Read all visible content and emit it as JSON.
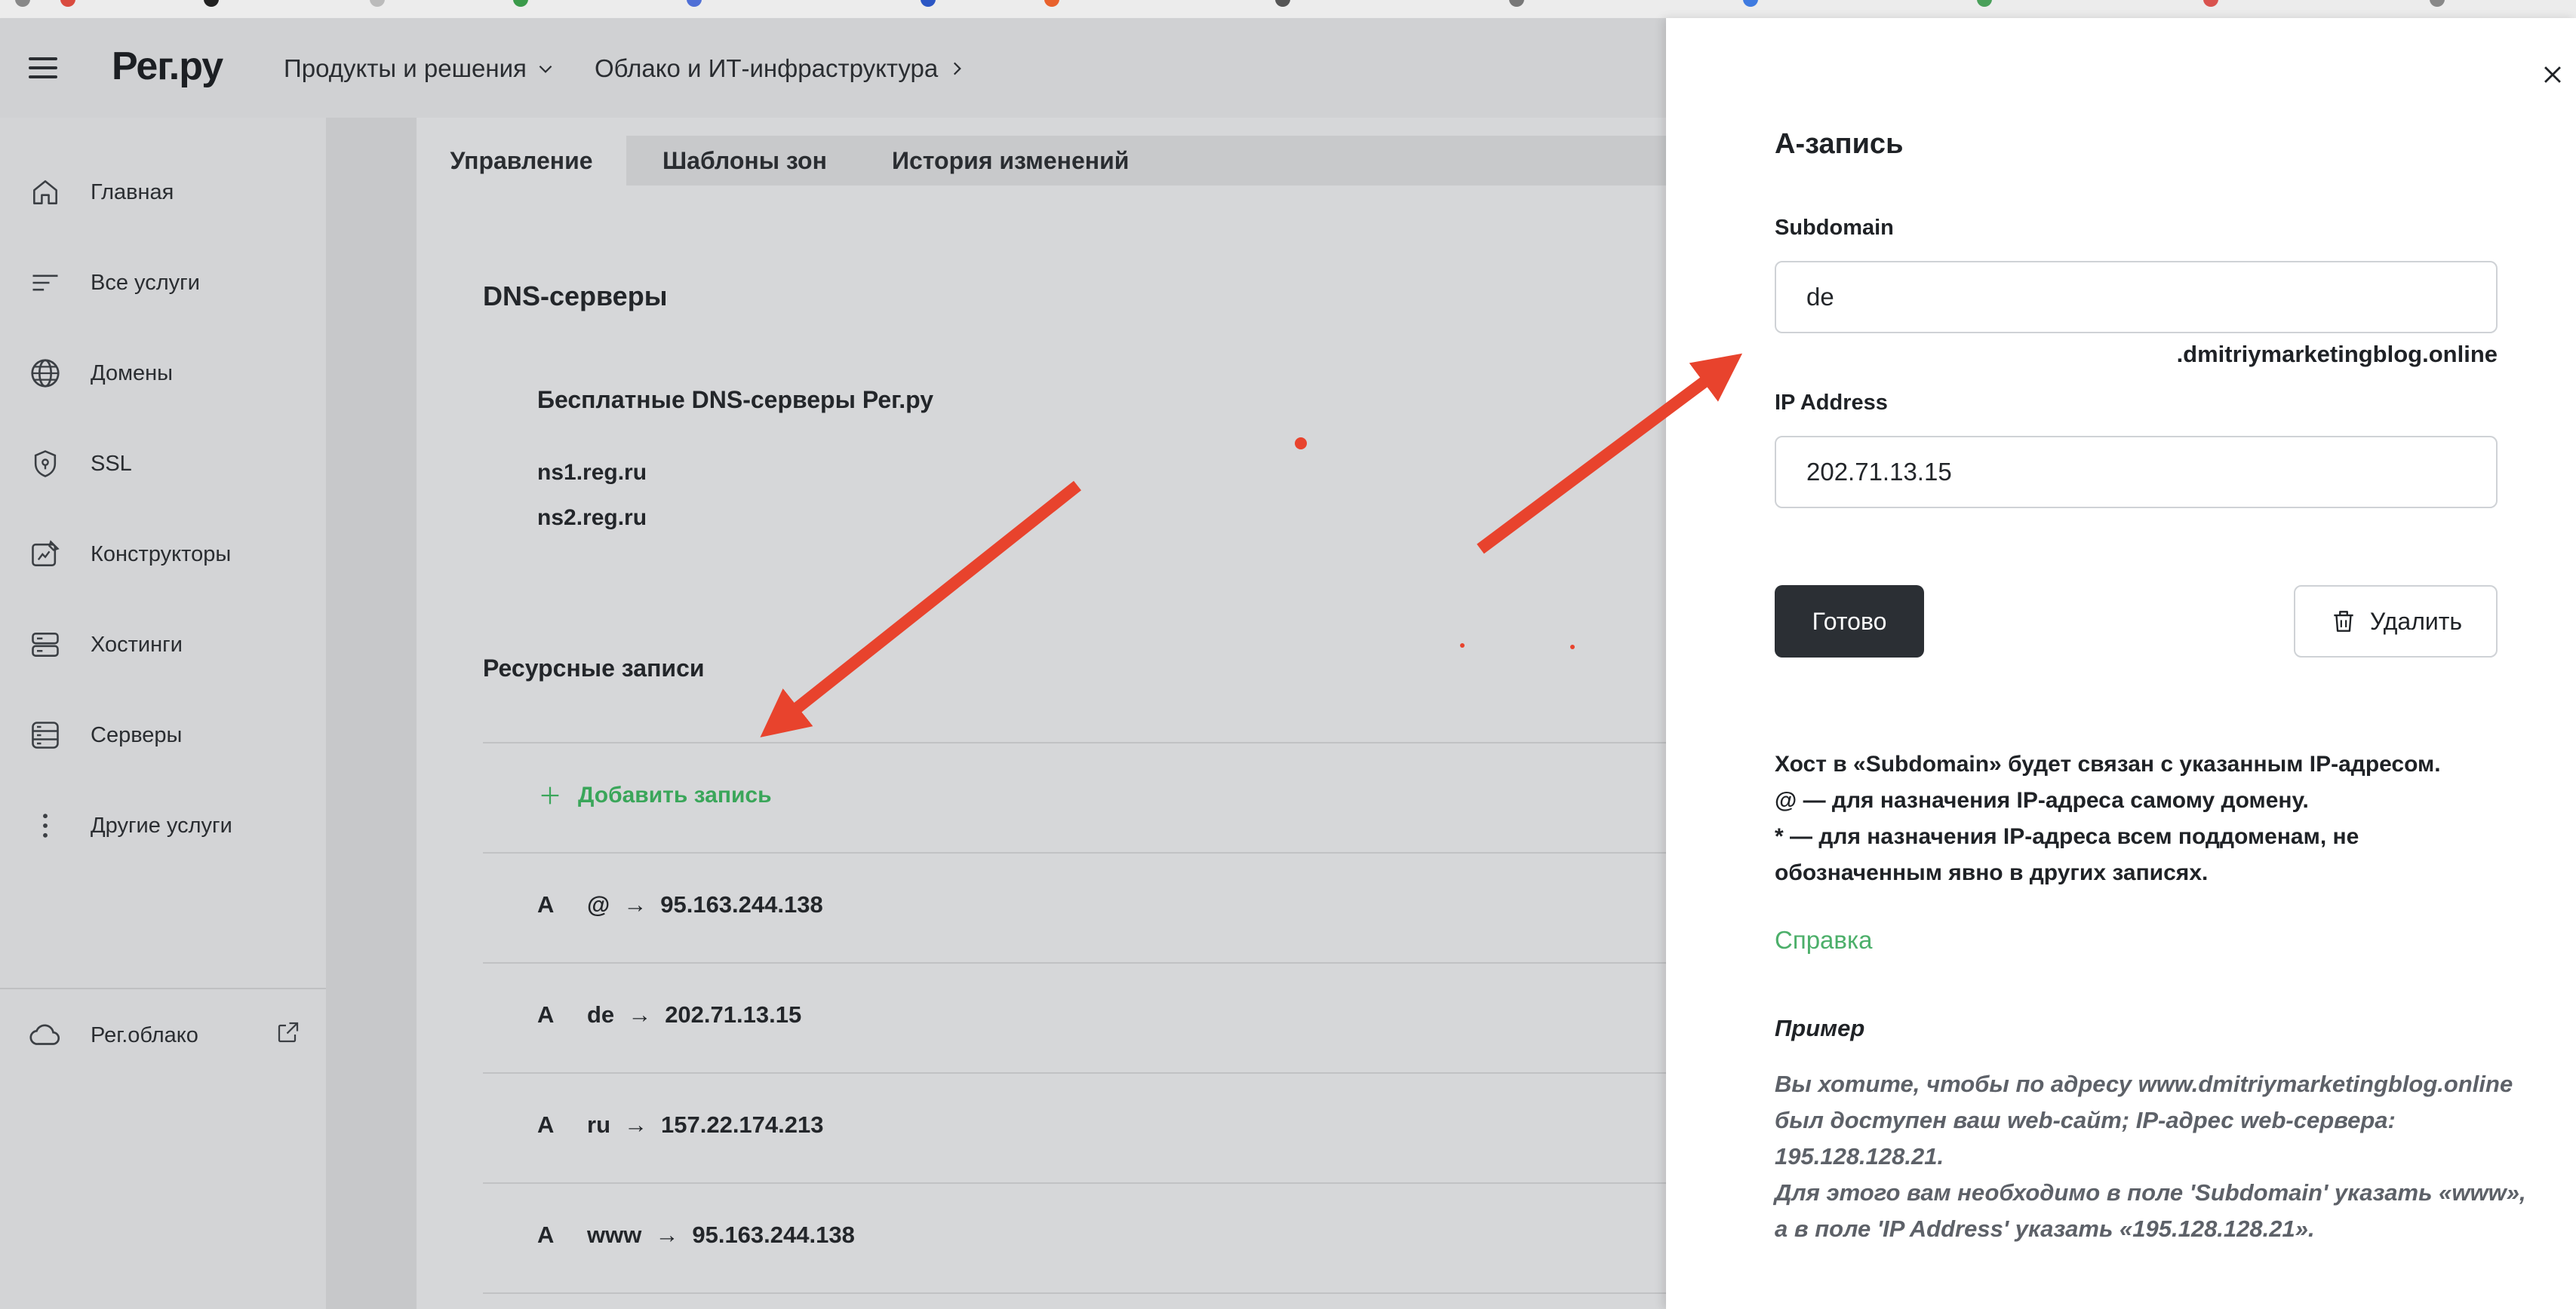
{
  "bookmarks": [
    {
      "label": "",
      "color": "#d94b3f"
    },
    {
      "label": "",
      "color": "#333333"
    },
    {
      "label": "",
      "color": "#b8b8b8"
    },
    {
      "label": "",
      "color": "#3a9a4a"
    },
    {
      "label": "",
      "color": "#4f6fd6"
    },
    {
      "label": "",
      "color": "#2b56c4"
    },
    {
      "label": "",
      "color": "#e8612c"
    },
    {
      "label": "",
      "color": "#555555"
    },
    {
      "label": "",
      "color": "#777777"
    },
    {
      "label": "",
      "color": "#3f7be0"
    },
    {
      "label": "",
      "color": "#4aa05a"
    },
    {
      "label": "",
      "color": "#d9534f"
    },
    {
      "label": "",
      "color": "#888888"
    }
  ],
  "header": {
    "logo": "Рег.ру",
    "nav": [
      {
        "label": "Продукты и решения",
        "icon": "chevron-down-icon"
      },
      {
        "label": "Облако и ИТ-инфраструктура",
        "icon": "chevron-right-icon"
      }
    ]
  },
  "sidebar": {
    "items": [
      {
        "label": "Главная",
        "icon": "home-icon"
      },
      {
        "label": "Все услуги",
        "icon": "list-icon"
      },
      {
        "label": "Домены",
        "icon": "globe-icon"
      },
      {
        "label": "SSL",
        "icon": "shield-icon"
      },
      {
        "label": "Конструкторы",
        "icon": "constructor-icon"
      },
      {
        "label": "Хостинги",
        "icon": "hosting-icon"
      },
      {
        "label": "Серверы",
        "icon": "server-icon"
      },
      {
        "label": "Другие услуги",
        "icon": "more-vertical-icon"
      }
    ],
    "cloud": {
      "label": "Рег.облако",
      "icon": "cloud-icon",
      "ext_icon": "external-link-icon"
    }
  },
  "main": {
    "tabs": [
      {
        "label": "Управление",
        "active": true
      },
      {
        "label": "Шаблоны зон",
        "active": false
      },
      {
        "label": "История изменений",
        "active": false
      }
    ],
    "dns_title": "DNS-серверы",
    "dns_group": "Бесплатные DNS-серверы Рег.ру",
    "dns_servers": [
      "ns1.reg.ru",
      "ns2.reg.ru"
    ],
    "records_title": "Ресурсные записи",
    "add_record": "Добавить запись",
    "records": [
      {
        "type": "A",
        "host": "@",
        "value": "95.163.244.138"
      },
      {
        "type": "A",
        "host": "de",
        "value": "202.71.13.15"
      },
      {
        "type": "A",
        "host": "ru",
        "value": "157.22.174.213"
      },
      {
        "type": "A",
        "host": "www",
        "value": "95.163.244.138"
      }
    ]
  },
  "panel": {
    "title": "А-запись",
    "subdomain_label": "Subdomain",
    "subdomain_value": "de",
    "domain_suffix": ".dmitriymarketingblog.online",
    "ip_label": "IP Address",
    "ip_value": "202.71.13.15",
    "done_button": "Готово",
    "delete_button": "Удалить",
    "hint_lines": [
      "Хост в «Subdomain» будет связан с указанным IP-адресом.",
      "@ — для назначения IP-адреса самому домену.",
      "* — для назначения IP-адреса всем поддоменам, не",
      "обозначенным явно в других записях."
    ],
    "help_link": "Справка",
    "example_title": "Пример",
    "example_lines": [
      "Вы хотите, чтобы по адресу www.dmitriymarketingblog.online",
      "был доступен ваш web-сайт; IP-адрес web-сервера:",
      "195.128.128.21.",
      "Для этого вам необходимо в поле 'Subdomain' указать «www»,",
      "а в поле 'IP Address' указать «195.128.128.21»."
    ]
  },
  "annotation_color": "#e8432d"
}
